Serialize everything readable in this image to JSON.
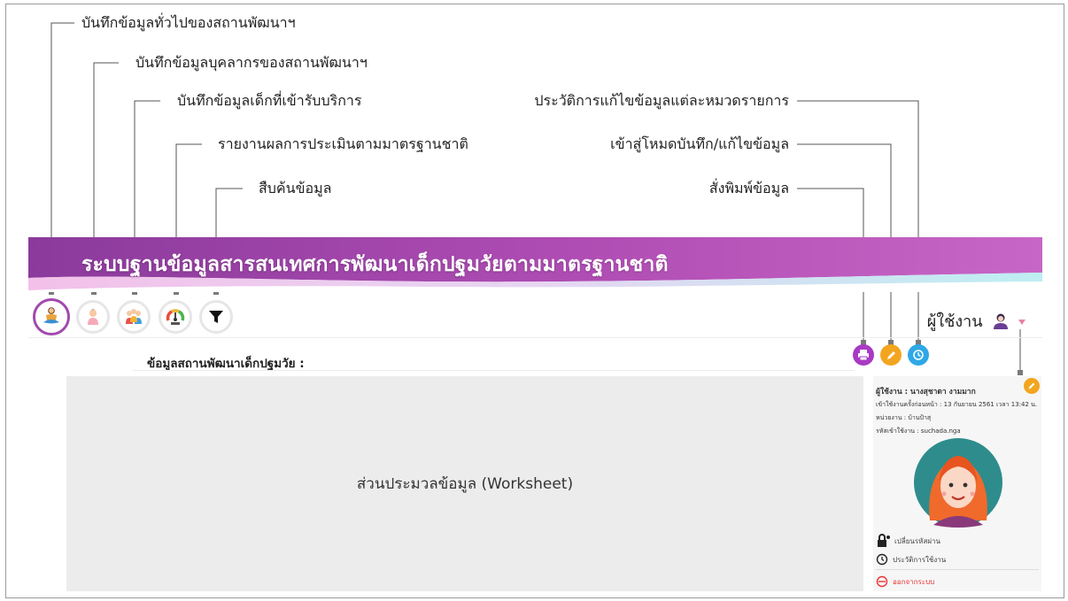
{
  "callouts_left": [
    "บันทึกข้อมูลทั่วไปของสถานพัฒนาฯ",
    "บันทึกข้อมูลบุคลากรของสถานพัฒนาฯ",
    "บันทึกข้อมูลเด็กที่เข้ารับบริการ",
    "รายงานผลการประเมินตามมาตรฐานชาติ",
    "สืบค้นข้อมูล"
  ],
  "callouts_right": [
    "ประวัติการแก้ไขข้อมูลแต่ละหมวดรายการ",
    "เข้าสู่โหมดบันทึก/แก้ไขข้อมูล",
    "สั่งพิมพ์ข้อมูล"
  ],
  "banner": {
    "title": "ระบบฐานข้อมูลสารสนเทศการพัฒนาเด็กปฐมวัยตามมาตรฐานชาติ",
    "color_start": "#8e3a9d",
    "color_end": "#c964c6"
  },
  "nav_icons": [
    "meditation-icon",
    "personnel-icon",
    "children-icon",
    "gauge-icon",
    "filter-icon"
  ],
  "header": {
    "user_label": "ผู้ใช้งาน"
  },
  "action_icons": {
    "print": {
      "icon": "printer-icon",
      "color": "#a83ac4"
    },
    "edit": {
      "icon": "pencil-icon",
      "color": "#f3a51f"
    },
    "history": {
      "icon": "history-icon",
      "color": "#2ea8e6"
    }
  },
  "section": {
    "label": "ข้อมูลสถานพัฒนาเด็กปฐมวัย :"
  },
  "worksheet": {
    "label": "ส่วนประมวลข้อมูล (Worksheet)"
  },
  "profile": {
    "name_line": "ผู้ใช้งาน : นางสุชาดา งามมาก",
    "last_login": "เข้าใช้งานครั้งก่อนหน้า : 13 กันยายน 2561 เวลา 13:42 น.",
    "unit": "หน่วยงาน : บ้านป้าสุ",
    "login_id": "รหัสเข้าใช้งาน : suchada.nga",
    "change_password": "เปลี่ยนรหัสผ่าน",
    "usage_history": "ประวัติการใช้งาน",
    "logout": "ออกจากระบบ"
  }
}
